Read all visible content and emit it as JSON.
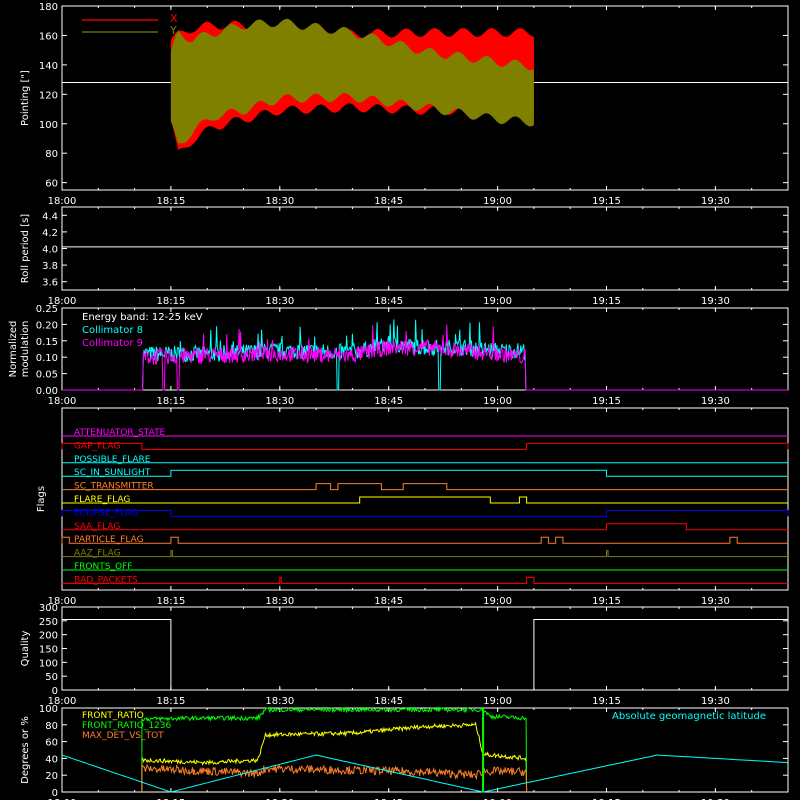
{
  "time_axis": {
    "start": "18:00",
    "end": "19:40",
    "ticks": [
      "18:00",
      "18:15",
      "18:30",
      "18:45",
      "19:00",
      "19:15",
      "19:30"
    ]
  },
  "chart_data": [
    {
      "type": "area",
      "ylabel": "Pointing [\"]",
      "ylim": [
        55,
        180
      ],
      "yticks": [
        60,
        80,
        100,
        120,
        140,
        160,
        180
      ],
      "reference_line": 128,
      "series": [
        {
          "name": "X",
          "color": "#ff0000",
          "x": [
            "18:15",
            "18:16",
            "18:18",
            "18:21",
            "18:25",
            "18:30",
            "18:40",
            "18:50",
            "19:00",
            "19:05"
          ],
          "upper": [
            160,
            163,
            168,
            170,
            170,
            166,
            164,
            165,
            165,
            165
          ],
          "lower": [
            100,
            76,
            86,
            95,
            100,
            106,
            108,
            106,
            106,
            105
          ]
        },
        {
          "name": "Y",
          "color": "#808000",
          "x": [
            "18:15",
            "18:16",
            "18:18",
            "18:21",
            "18:25",
            "18:30",
            "18:40",
            "18:50",
            "19:00",
            "19:05"
          ],
          "upper": [
            150,
            165,
            160,
            165,
            170,
            172,
            165,
            152,
            145,
            142
          ],
          "lower": [
            96,
            82,
            92,
            102,
            106,
            114,
            115,
            108,
            100,
            98
          ]
        }
      ]
    },
    {
      "type": "line",
      "ylabel": "Roll period [s]",
      "ylim": [
        3.5,
        4.5
      ],
      "yticks": [
        3.6,
        3.8,
        4.0,
        4.2,
        4.4
      ],
      "value": 4.02
    },
    {
      "type": "line",
      "ylabel": "Normalized modulation",
      "ylim": [
        0,
        0.25
      ],
      "yticks": [
        0.0,
        0.05,
        0.1,
        0.15,
        0.2,
        0.25
      ],
      "annotation": "Energy band: 12-25 keV",
      "active_start": "18:11",
      "active_end": "19:04",
      "series": [
        {
          "name": "Collimator 8",
          "color": "#00ffff",
          "x": [
            "18:11",
            "18:20",
            "18:30",
            "18:40",
            "18:45",
            "18:50",
            "18:55",
            "19:00",
            "19:04"
          ],
          "y": [
            0.11,
            0.11,
            0.12,
            0.115,
            0.14,
            0.13,
            0.13,
            0.12,
            0.12
          ],
          "dropouts": [
            "18:38",
            "18:52"
          ]
        },
        {
          "name": "Collimator 9",
          "color": "#ff00ff",
          "x": [
            "18:11",
            "18:20",
            "18:30",
            "18:40",
            "18:45",
            "18:50",
            "18:55",
            "19:00",
            "19:04"
          ],
          "y": [
            0.1,
            0.105,
            0.11,
            0.105,
            0.13,
            0.13,
            0.12,
            0.11,
            0.1
          ],
          "dropouts": [
            "18:11",
            "18:14",
            "18:16"
          ]
        }
      ]
    },
    {
      "type": "table",
      "ylabel": "Flags",
      "flags": [
        {
          "name": "ATTENUATOR_STATE",
          "color": "#ff00ff",
          "on": []
        },
        {
          "name": "GAP_FLAG",
          "color": "#ff0000",
          "on": [
            [
              "18:00",
              "18:11"
            ],
            [
              "19:04",
              "19:40"
            ]
          ]
        },
        {
          "name": "POSSIBLE_FLARE",
          "color": "#00ffff",
          "on": []
        },
        {
          "name": "SC_IN_SUNLIGHT",
          "color": "#00ffff",
          "on": [
            [
              "18:15",
              "19:15"
            ]
          ]
        },
        {
          "name": "SC_TRANSMITTER",
          "color": "#ff7f27",
          "on": [
            [
              "18:35",
              "18:37"
            ],
            [
              "18:38",
              "18:44"
            ],
            [
              "18:47",
              "18:53"
            ]
          ]
        },
        {
          "name": "FLARE_FLAG",
          "color": "#ffff00",
          "on": [
            [
              "18:41",
              "18:59"
            ],
            [
              "19:03",
              "19:04"
            ]
          ]
        },
        {
          "name": "ECLIPSE_FLAG",
          "color": "#0000ff",
          "on": [
            [
              "18:00",
              "18:15"
            ],
            [
              "19:15",
              "19:40"
            ]
          ]
        },
        {
          "name": "SAA_FLAG",
          "color": "#ff0000",
          "on": [
            [
              "19:15",
              "19:26"
            ]
          ]
        },
        {
          "name": "PARTICLE_FLAG",
          "color": "#ff7f27",
          "on": [
            [
              "18:00",
              "18:01"
            ],
            [
              "18:15",
              "18:16"
            ],
            [
              "19:06",
              "19:07"
            ],
            [
              "19:08",
              "19:09"
            ],
            [
              "19:32",
              "19:33"
            ]
          ]
        },
        {
          "name": "AAZ_FLAG",
          "color": "#808000",
          "on": [
            [
              "18:15",
              "18:15"
            ],
            [
              "19:15",
              "19:15"
            ]
          ]
        },
        {
          "name": "FRONTS_OFF",
          "color": "#00ff00",
          "on": []
        },
        {
          "name": "BAD_PACKETS",
          "color": "#ff0000",
          "on": [
            [
              "18:30",
              "18:30"
            ],
            [
              "19:04",
              "19:05"
            ]
          ]
        }
      ]
    },
    {
      "type": "line",
      "ylabel": "Quality",
      "ylim": [
        0,
        300
      ],
      "yticks": [
        0,
        50,
        100,
        150,
        200,
        250,
        300
      ],
      "segments": [
        {
          "x": [
            "18:00",
            "18:15"
          ],
          "y": 255
        },
        {
          "x": [
            "18:15",
            "19:05"
          ],
          "y": 0
        },
        {
          "x": [
            "19:05",
            "19:40"
          ],
          "y": 255
        }
      ]
    },
    {
      "type": "line",
      "ylabel": "Degrees or %",
      "ylim": [
        0,
        100
      ],
      "yticks": [
        0,
        20,
        40,
        60,
        80,
        100
      ],
      "series": [
        {
          "name": "FRONT_RATIO",
          "color": "#ffff00",
          "x": [
            "18:11",
            "18:20",
            "18:27",
            "18:28",
            "18:40",
            "18:50",
            "18:57",
            "18:58",
            "19:04"
          ],
          "y": [
            38,
            35,
            38,
            68,
            70,
            78,
            80,
            45,
            40
          ]
        },
        {
          "name": "FRONT_RATIO_1236",
          "color": "#00ff00",
          "x": [
            "18:11",
            "18:20",
            "18:27",
            "18:28",
            "18:40",
            "18:50",
            "18:58",
            "18:59",
            "19:04"
          ],
          "y": [
            87,
            88,
            88,
            98,
            98,
            98,
            98,
            90,
            88
          ]
        },
        {
          "name": "MAX_DET_VS_TOT",
          "color": "#ff7f27",
          "x": [
            "18:11",
            "18:20",
            "18:27",
            "18:28",
            "18:40",
            "18:50",
            "18:57",
            "18:58",
            "19:04"
          ],
          "y": [
            28,
            25,
            22,
            28,
            26,
            24,
            20,
            25,
            24
          ]
        },
        {
          "name": "Absolute geomagnetic latitude",
          "color": "#00ffff",
          "x": [
            "18:00",
            "18:15",
            "18:35",
            "18:58",
            "19:22",
            "19:40"
          ],
          "y": [
            44,
            0,
            44,
            0,
            44,
            35
          ]
        }
      ]
    }
  ]
}
